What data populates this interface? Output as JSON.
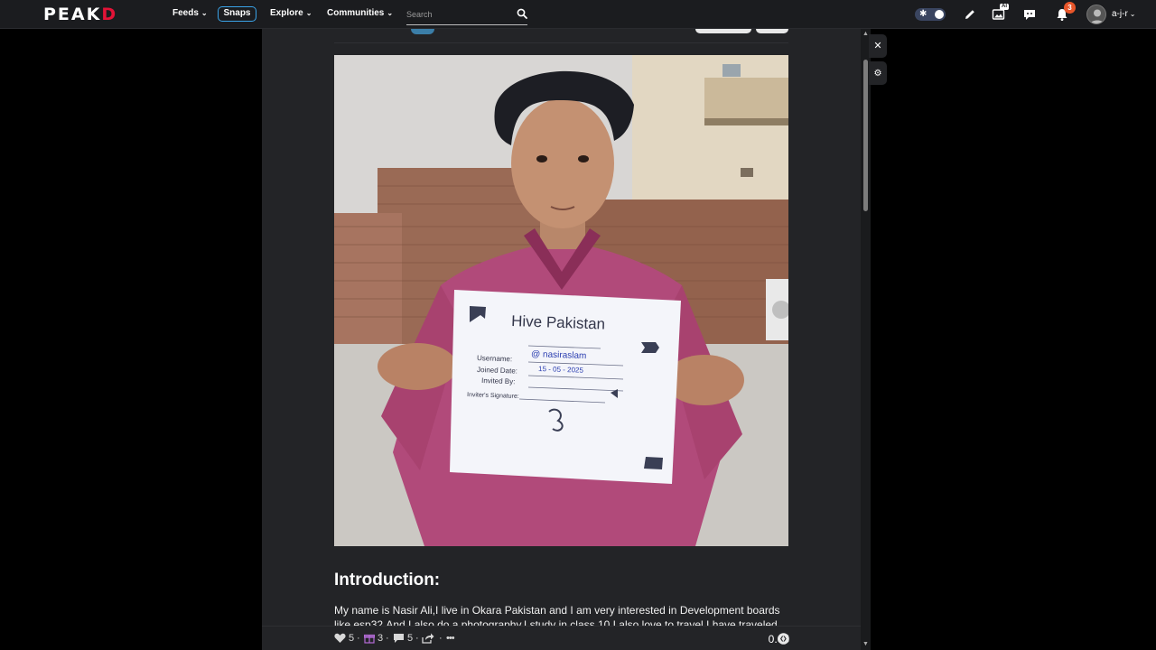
{
  "header": {
    "logo_pe": "PE",
    "logo_ak": "AK",
    "logo_d": "D",
    "nav": [
      {
        "label": "Feeds"
      },
      {
        "label": "Snaps"
      },
      {
        "label": "Explore"
      },
      {
        "label": "Communities"
      }
    ],
    "search_placeholder": "Search",
    "ai_label": "AI",
    "notification_count": "3",
    "username": "a-j-r"
  },
  "post": {
    "card": {
      "title": "Hive Pakistan",
      "username_label": "Username:",
      "username_value": "@ nasiraslam",
      "joined_label": "Joined Date:",
      "joined_value": "15 - 05 - 2025",
      "invited_label": "Invited By:",
      "signature_label": "Inviter's Signature:"
    },
    "heading": "Introduction:",
    "body": "My name is Nasir Ali,I live in Okara Pakistan and I am very interested in Development boards like esp32.And I also do a photography.I study in class 10.I also love to travel.I have traveled to many"
  },
  "actions": {
    "votes": "5",
    "gifts": "3",
    "comments": "5",
    "payout": "0.05"
  },
  "colors": {
    "accent": "#3aa3e8",
    "brand_red": "#e31337",
    "badge": "#e8562a",
    "shirt": "#b14a7a"
  }
}
